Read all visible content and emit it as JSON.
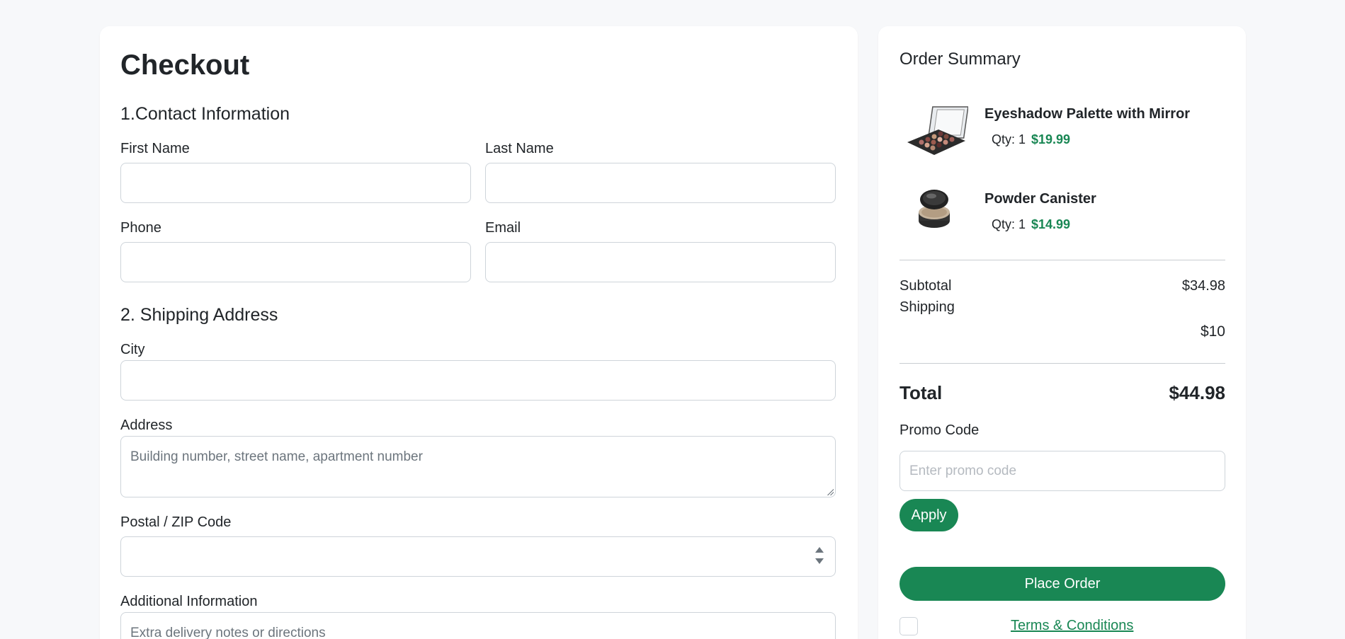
{
  "checkout": {
    "title": "Checkout",
    "contact_section": "1.Contact Information",
    "shipping_section": "2. Shipping Address",
    "fields": {
      "first_name": {
        "label": "First Name",
        "value": "",
        "placeholder": ""
      },
      "last_name": {
        "label": "Last Name",
        "value": "",
        "placeholder": ""
      },
      "phone": {
        "label": "Phone",
        "value": "",
        "placeholder": ""
      },
      "email": {
        "label": "Email",
        "value": "",
        "placeholder": ""
      },
      "city": {
        "label": "City",
        "value": "",
        "placeholder": ""
      },
      "address": {
        "label": "Address",
        "value": "",
        "placeholder": "Building number, street name, apartment number"
      },
      "postal": {
        "label": "Postal / ZIP Code",
        "value": "",
        "placeholder": ""
      },
      "additional": {
        "label": "Additional Information",
        "value": "",
        "placeholder": "Extra delivery notes or directions"
      }
    }
  },
  "summary": {
    "title": "Order Summary",
    "items": [
      {
        "name": "Eyeshadow Palette with Mirror",
        "qty": "Qty: 1",
        "price": "$19.99",
        "icon": "eyeshadow-palette-image"
      },
      {
        "name": "Powder Canister",
        "qty": "Qty: 1",
        "price": "$14.99",
        "icon": "powder-canister-image"
      }
    ],
    "subtotal_label": "Subtotal",
    "subtotal_value": "$34.98",
    "shipping_label": "Shipping",
    "shipping_value": "$10",
    "total_label": "Total",
    "total_value": "$44.98",
    "promo_label": "Promo Code",
    "promo_placeholder": "Enter promo code",
    "apply_label": "Apply",
    "place_order_label": "Place Order",
    "terms_label": "Terms & Conditions"
  },
  "colors": {
    "accent_green": "#198754",
    "page_background": "#f7f8fa",
    "card_background": "#ffffff"
  }
}
